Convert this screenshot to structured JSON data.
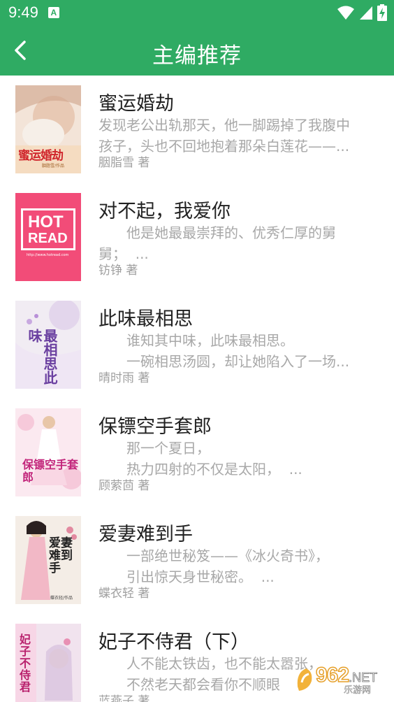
{
  "status_bar": {
    "time": "9:49",
    "notification_icon": "A"
  },
  "header": {
    "title": "主编推荐"
  },
  "books": [
    {
      "title": "蜜运婚劫",
      "desc_line1": "发现老公出轨那天，他一脚踢掉了我腹中",
      "desc_line2": "孩子，头也不回地抱着那朵白莲花——...",
      "author": "胭脂雪 著",
      "cover_text": "蜜运婚劫",
      "cover_sub": "胭脂雪/作品"
    },
    {
      "title": "对不起，我爱你",
      "desc_line1": "　　他是她最最崇拜的、优秀仁厚的舅",
      "desc_line2": "舅；  ...",
      "author": "钫铮 著",
      "cover_text": "HOT",
      "cover_text2": "READ",
      "cover_sub": "http://www.hotread.com"
    },
    {
      "title": "此味最相思",
      "desc_line1": "　　谁知其中味，此味最相思。",
      "desc_line2": "　　一碗相思汤圆，却让她陷入了一场...",
      "author": "晴时雨 著",
      "cover_text": "最相思此味"
    },
    {
      "title": "保镖空手套郎",
      "desc_line1": "　　那一个夏日，",
      "desc_line2": "　　热力四射的不仅是太阳，  ...",
      "author": "顾萦茴 著",
      "cover_text": "保镖空手套郎"
    },
    {
      "title": "爱妻难到手",
      "desc_line1": "　　一部绝世秘笈——《冰火奇书》，",
      "desc_line2": "　　引出惊天身世秘密。  ...",
      "author": "蝶衣轻 著",
      "cover_text": "爱妻难到手",
      "cover_sub": "蝶衣轻/作品"
    },
    {
      "title": "妃子不侍君（下）",
      "desc_line1": "　　人不能太铁齿，也不能太嚣张，",
      "desc_line2": "　　不然老天都会看你不顺眼",
      "author": "蓝燕子 著",
      "cover_text": "妃子不侍君"
    }
  ],
  "watermark": {
    "number": "962",
    "suffix": ".NET",
    "sub": "乐游网"
  }
}
